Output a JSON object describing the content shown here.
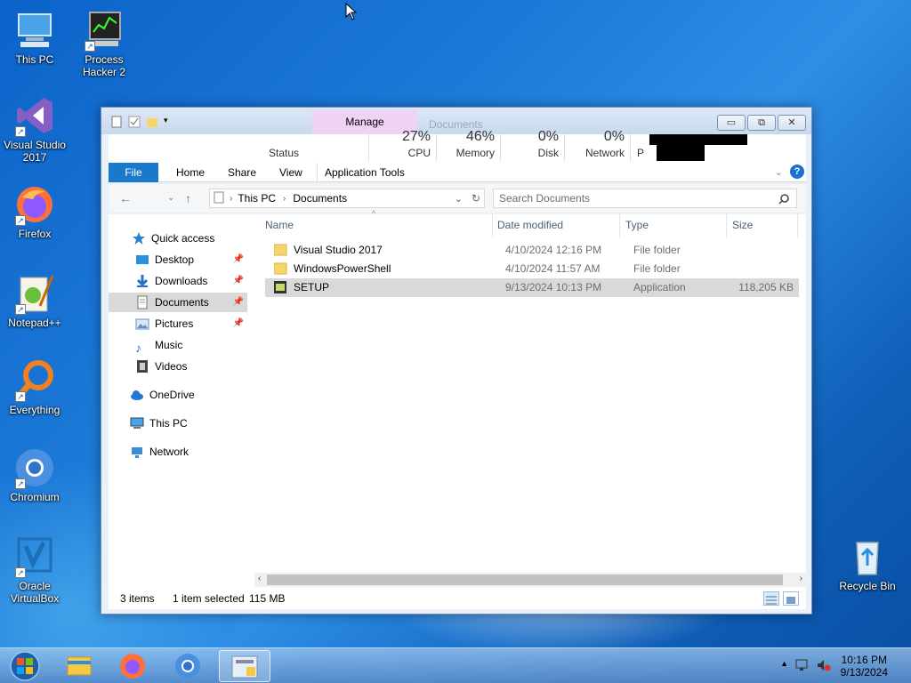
{
  "desktop": {
    "icons": [
      {
        "label": "This PC"
      },
      {
        "label": "Process Hacker 2"
      },
      {
        "label": "Visual Studio 2017"
      },
      {
        "label": "Firefox"
      },
      {
        "label": "Notepad++"
      },
      {
        "label": "Everything"
      },
      {
        "label": "Chromium"
      },
      {
        "label": "Oracle VirtualBox"
      },
      {
        "label": "Recycle Bin"
      }
    ]
  },
  "window": {
    "manage_tab": "Manage",
    "title": "Documents",
    "perf": {
      "status_label": "Status",
      "cpu": {
        "value": "27%",
        "label": "CPU"
      },
      "memory": {
        "value": "46%",
        "label": "Memory"
      },
      "disk": {
        "value": "0%",
        "label": "Disk"
      },
      "network": {
        "value": "0%",
        "label": "Network"
      },
      "p_label": "P"
    },
    "ribbon_tabs": [
      "File",
      "Home",
      "Share",
      "View",
      "Application Tools"
    ],
    "address": {
      "segments": [
        "This PC",
        "Documents"
      ]
    },
    "search": {
      "placeholder": "Search Documents"
    },
    "nav": {
      "quick_access": "Quick access",
      "items": [
        "Desktop",
        "Downloads",
        "Documents",
        "Pictures",
        "Music",
        "Videos"
      ],
      "onedrive": "OneDrive",
      "this_pc": "This PC",
      "network": "Network"
    },
    "columns": [
      "Name",
      "Date modified",
      "Type",
      "Size"
    ],
    "files": [
      {
        "name": "Visual Studio 2017",
        "date": "4/10/2024 12:16 PM",
        "type": "File folder",
        "size": ""
      },
      {
        "name": "WindowsPowerShell",
        "date": "4/10/2024 11:57 AM",
        "type": "File folder",
        "size": ""
      },
      {
        "name": "SETUP",
        "date": "9/13/2024 10:13 PM",
        "type": "Application",
        "size": "118,205 KB"
      }
    ],
    "status": {
      "items": "3 items",
      "selected": "1 item selected",
      "size": "115 MB"
    }
  },
  "taskbar": {
    "time": "10:16 PM",
    "date": "9/13/2024"
  },
  "colors": {
    "accent": "#1979ca",
    "manage_tab": "#f0d2f5",
    "selection": "#d9d9d9"
  }
}
